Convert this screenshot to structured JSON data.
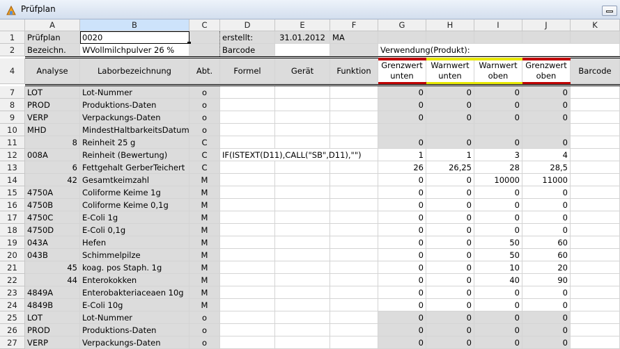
{
  "window": {
    "title": "Prüfplan"
  },
  "colors": {
    "red": "#c00000",
    "yellow": "#e8e800"
  },
  "columns": [
    "A",
    "B",
    "C",
    "D",
    "E",
    "F",
    "G",
    "H",
    "I",
    "J",
    "K"
  ],
  "selected_column": "B",
  "row1": {
    "row_number": "1",
    "a": "Prüfplan",
    "b": "0020",
    "d": "erstellt:",
    "e": "31.01.2012",
    "f": "MA"
  },
  "row2": {
    "row_number": "2",
    "a": "Bezeichn.",
    "b": "WVollmilchpulver 26 %",
    "d": "Barcode",
    "gh": "Verwendung(Produkt):"
  },
  "header_row": {
    "row_number": "4",
    "a": "Analyse",
    "b": "Laborbezeichnung",
    "c": "Abt.",
    "d": "Formel",
    "e": "Gerät",
    "f": "Funktion",
    "g": "Grenzwert unten",
    "h": "Warnwert unten",
    "i": "Warnwert oben",
    "j": "Grenzwert oben",
    "k": "Barcode"
  },
  "rows": [
    {
      "n": "7",
      "a": "LOT",
      "b": "Lot-Nummer",
      "c": "o",
      "d": "",
      "g": "0",
      "h": "0",
      "i": "0",
      "j": "0"
    },
    {
      "n": "8",
      "a": "PROD",
      "b": "Produktions-Daten",
      "c": "o",
      "d": "",
      "g": "0",
      "h": "0",
      "i": "0",
      "j": "0"
    },
    {
      "n": "9",
      "a": "VERP",
      "b": "Verpackungs-Daten",
      "c": "o",
      "d": "",
      "g": "0",
      "h": "0",
      "i": "0",
      "j": "0"
    },
    {
      "n": "10",
      "a": "MHD",
      "b": "MindestHaltbarkeitsDatum",
      "c": "o",
      "d": "",
      "g": "",
      "h": "",
      "i": "",
      "j": ""
    },
    {
      "n": "11",
      "a": "8",
      "b": "Reinheit 25 g",
      "c": "C",
      "d": "",
      "g": "0",
      "h": "0",
      "i": "0",
      "j": "0"
    },
    {
      "n": "12",
      "a": "008A",
      "b": "Reinheit (Bewertung)",
      "c": "C",
      "d": "IF(ISTEXT(D11),CALL(\"SB\",D11),\"\")",
      "g": "1",
      "h": "1",
      "i": "3",
      "j": "4"
    },
    {
      "n": "13",
      "a": "6",
      "b": "Fettgehalt GerberTeichert",
      "c": "C",
      "d": "",
      "g": "26",
      "h": "26,25",
      "i": "28",
      "j": "28,5"
    },
    {
      "n": "14",
      "a": "42",
      "b": "Gesamtkeimzahl",
      "c": "M",
      "d": "",
      "g": "0",
      "h": "0",
      "i": "10000",
      "j": "11000"
    },
    {
      "n": "15",
      "a": "4750A",
      "b": "Coliforme Keime 1g",
      "c": "M",
      "d": "",
      "g": "0",
      "h": "0",
      "i": "0",
      "j": "0"
    },
    {
      "n": "16",
      "a": "4750B",
      "b": "Coliforme Keime 0,1g",
      "c": "M",
      "d": "",
      "g": "0",
      "h": "0",
      "i": "0",
      "j": "0"
    },
    {
      "n": "17",
      "a": "4750C",
      "b": "E-Coli 1g",
      "c": "M",
      "d": "",
      "g": "0",
      "h": "0",
      "i": "0",
      "j": "0"
    },
    {
      "n": "18",
      "a": "4750D",
      "b": "E-Coli 0,1g",
      "c": "M",
      "d": "",
      "g": "0",
      "h": "0",
      "i": "0",
      "j": "0"
    },
    {
      "n": "19",
      "a": "043A",
      "b": "Hefen",
      "c": "M",
      "d": "",
      "g": "0",
      "h": "0",
      "i": "50",
      "j": "60"
    },
    {
      "n": "20",
      "a": "043B",
      "b": "Schimmelpilze",
      "c": "M",
      "d": "",
      "g": "0",
      "h": "0",
      "i": "50",
      "j": "60"
    },
    {
      "n": "21",
      "a": "45",
      "b": "koag. pos Staph. 1g",
      "c": "M",
      "d": "",
      "g": "0",
      "h": "0",
      "i": "10",
      "j": "20"
    },
    {
      "n": "22",
      "a": "44",
      "b": "Enterokokken",
      "c": "M",
      "d": "",
      "g": "0",
      "h": "0",
      "i": "40",
      "j": "90"
    },
    {
      "n": "23",
      "a": "4849A",
      "b": "Enterobakteriaceaen 10g",
      "c": "M",
      "d": "",
      "g": "0",
      "h": "0",
      "i": "0",
      "j": "0"
    },
    {
      "n": "24",
      "a": "4849B",
      "b": "E-Coli 10g",
      "c": "M",
      "d": "",
      "g": "0",
      "h": "0",
      "i": "0",
      "j": "0"
    },
    {
      "n": "25",
      "a": "LOT",
      "b": "Lot-Nummer",
      "c": "o",
      "d": "",
      "g": "0",
      "h": "0",
      "i": "0",
      "j": "0"
    },
    {
      "n": "26",
      "a": "PROD",
      "b": "Produktions-Daten",
      "c": "o",
      "d": "",
      "g": "0",
      "h": "0",
      "i": "0",
      "j": "0"
    },
    {
      "n": "27",
      "a": "VERP",
      "b": "Verpackungs-Daten",
      "c": "o",
      "d": "",
      "g": "0",
      "h": "0",
      "i": "0",
      "j": "0"
    }
  ]
}
